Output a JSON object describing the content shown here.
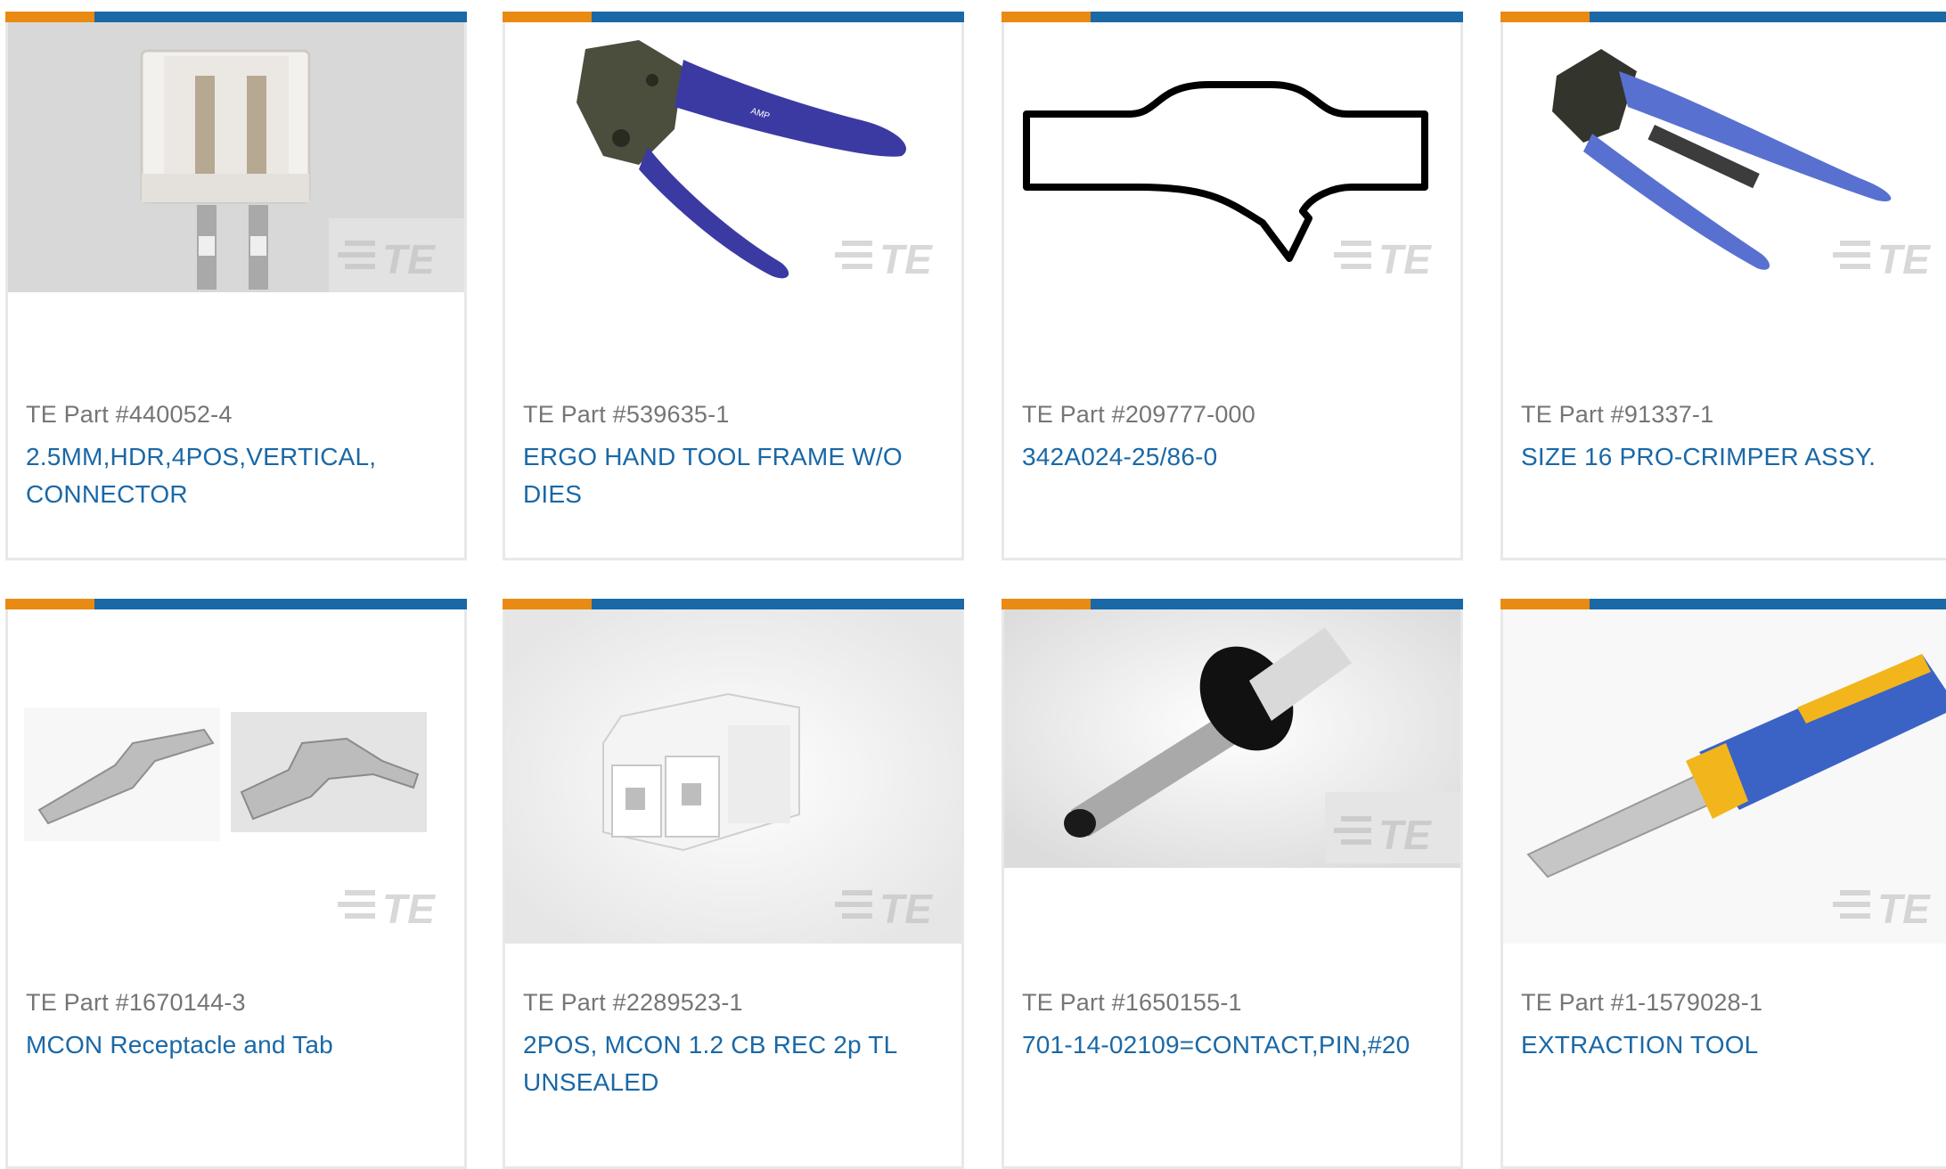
{
  "colors": {
    "accent_orange": "#e98a13",
    "accent_blue": "#1a68a6",
    "part_gray": "#757575",
    "border": "#e8e8e8"
  },
  "brand_watermark": "TE",
  "products": [
    {
      "part_number": "TE Part #440052-4",
      "description": "2.5MM,HDR,4POS,VERTICAL, CONNECTOR",
      "image": "header-connector-photo"
    },
    {
      "part_number": "TE Part #539635-1",
      "description": "ERGO HAND TOOL FRAME W/O DIES",
      "image": "crimp-hand-tool-photo"
    },
    {
      "part_number": "TE Part #209777-000",
      "description": "342A024-25/86-0",
      "image": "heat-shrink-boot-drawing"
    },
    {
      "part_number": "TE Part #91337-1",
      "description": "SIZE 16 PRO-CRIMPER ASSY.",
      "image": "pro-crimper-photo"
    },
    {
      "part_number": "TE Part #1670144-3",
      "description": "MCON Receptacle and Tab",
      "image": "receptacle-and-tab-photo"
    },
    {
      "part_number": "TE Part #2289523-1",
      "description": "2POS, MCON 1.2 CB REC 2p TL UNSEALED",
      "image": "two-position-housing-photo"
    },
    {
      "part_number": "TE Part #1650155-1",
      "description": "701-14-02109=CONTACT,PIN,#20",
      "image": "contact-pin-photo"
    },
    {
      "part_number": "TE Part #1-1579028-1",
      "description": "EXTRACTION TOOL",
      "image": "extraction-tool-photo"
    }
  ]
}
